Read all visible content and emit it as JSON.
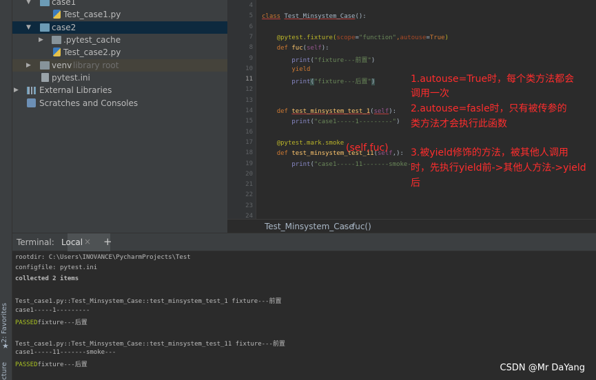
{
  "side_strip": {
    "favorites": "2: Favorites",
    "structure": "Structure",
    "star": "★"
  },
  "project_tree": {
    "items": [
      {
        "label": "case1",
        "kind": "folder"
      },
      {
        "label": "Test_case1.py",
        "kind": "python-file"
      },
      {
        "label": "case2",
        "kind": "folder"
      },
      {
        "label": ".pytest_cache",
        "kind": "folder"
      },
      {
        "label": "Test_case2.py",
        "kind": "python-file"
      },
      {
        "label": "venv",
        "kind": "folder",
        "hint": "library root"
      },
      {
        "label": "pytest.ini",
        "kind": "ini-file"
      },
      {
        "label": "External Libraries",
        "kind": "libraries"
      },
      {
        "label": "Scratches and Consoles",
        "kind": "scratches"
      }
    ]
  },
  "editor": {
    "line_numbers": [
      "4",
      "5",
      "6",
      "7",
      "8",
      "9",
      "10",
      "11",
      "12",
      "13",
      "14",
      "15",
      "16",
      "17",
      "18",
      "19",
      "20",
      "21",
      "22",
      "23",
      "24"
    ],
    "current_line": "11",
    "code": {
      "l5": {
        "kw": "class",
        "name": "Test_Minsystem_Case",
        "rest": "():"
      },
      "l7": {
        "dec": "@pytest.fixture(",
        "prm1": "scope",
        "eq1": "=",
        "str1": "\"function\"",
        "sep": ",",
        "prm2": "autouse",
        "eq2": "=",
        "val": "True",
        "close": ")"
      },
      "l8": {
        "kw": "def",
        "name": "fuc",
        "open": "(",
        "self": "self",
        "close": "):"
      },
      "l9": {
        "blt": "print",
        "open": "(",
        "str": "\"fixture---前置\"",
        "close": ")"
      },
      "l10": {
        "kw": "yield"
      },
      "l11": {
        "blt": "print",
        "open": "(",
        "str": "\"fixture---后置\"",
        "close": ")"
      },
      "l14": {
        "kw": "def",
        "name": "test_minsystem_test_1",
        "open": "(",
        "self": "self",
        "close": "):"
      },
      "l15": {
        "blt": "print",
        "open": "(",
        "str": "\"case1-----1---------\"",
        "close": ")"
      },
      "l17": {
        "dec": "@pytest.mark.smoke"
      },
      "l18": {
        "kw": "def",
        "name": "test_minsystem_test_11",
        "open": "(",
        "self": "self",
        "close": ",):"
      },
      "l19": {
        "blt": "print",
        "open": "(",
        "str": "\"case1-----11-------smoke-"
      }
    },
    "annotation_inline": "(self,fuc)",
    "annotations": [
      "1.autouse=True时，每个类方法都会",
      "调用一次",
      "2.autouse=fasle时，只有被传参的",
      "类方法才会执行此函数",
      "3.被yield修饰的方法，被其他人调用",
      "时，先执行yield前->其他人方法->yield",
      "后"
    ]
  },
  "breadcrumb": {
    "class": "Test_Minsystem_Case",
    "sep": "›",
    "method": "fuc()"
  },
  "terminal": {
    "title": "Terminal:",
    "tab": "Local",
    "close": "×",
    "add": "+",
    "lines": [
      {
        "text": "rootdir: C:\\Users\\INOVANCE\\PycharmProjects\\Test"
      },
      {
        "text": "configfile: pytest.ini"
      },
      {
        "text": "collected 2 items"
      },
      {
        "text": ""
      },
      {
        "text": "Test_case1.py::Test_Minsystem_Case::test_minsystem_test_1 fixture---前置"
      },
      {
        "text": "case1-----1---------"
      },
      {
        "passed": "PASSED",
        "text": "fixture---后置"
      },
      {
        "text": ""
      },
      {
        "text": "Test_case1.py::Test_Minsystem_Case::test_minsystem_test_11 fixture---前置"
      },
      {
        "text": "case1-----11-------smoke---"
      },
      {
        "passed": "PASSED",
        "text": "fixture---后置"
      }
    ]
  },
  "watermark": "CSDN @Mr DaYang"
}
